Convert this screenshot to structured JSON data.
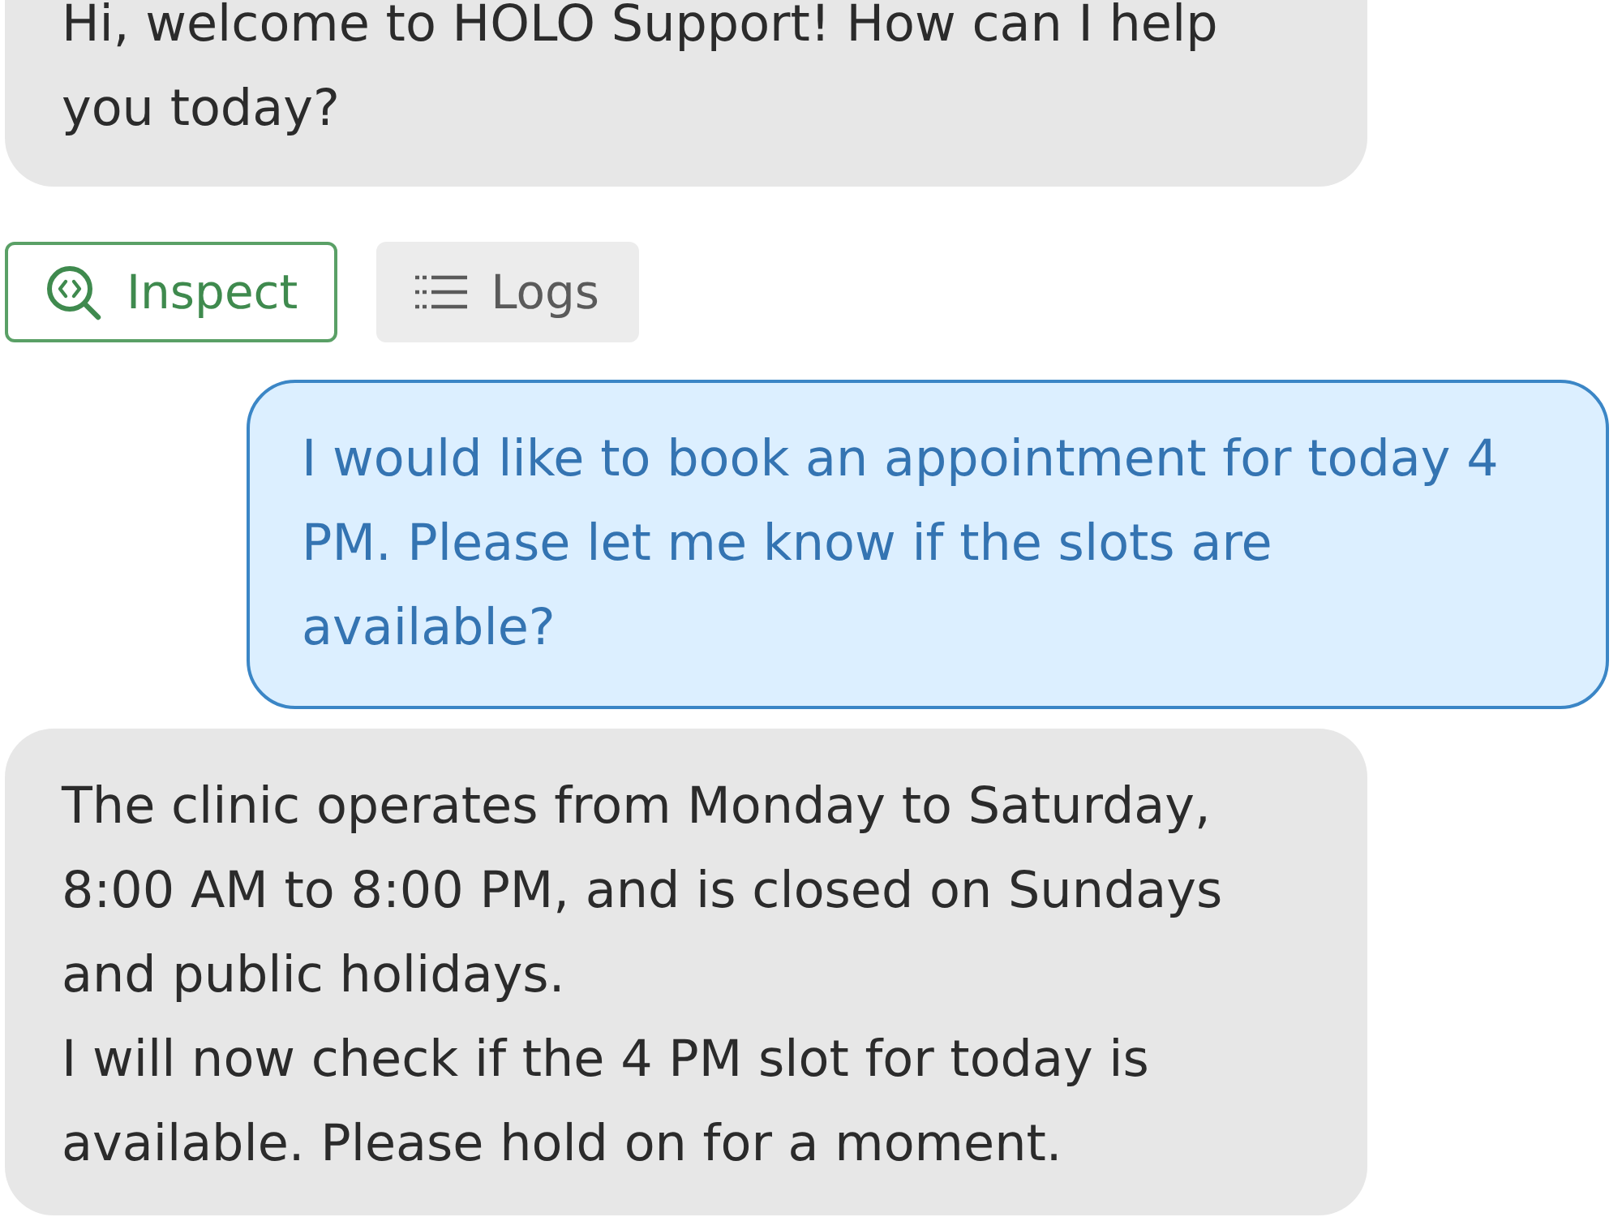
{
  "conversation": [
    {
      "kind": "incoming",
      "paragraphs": [
        "Hi, welcome to HOLO Support! How can I help you today?"
      ],
      "actions": [
        {
          "kind": "inspect",
          "label": "Inspect",
          "selected": true
        },
        {
          "kind": "logs",
          "label": "Logs",
          "selected": false
        }
      ]
    },
    {
      "kind": "outgoing",
      "paragraphs": [
        "I would like to book an appointment for today 4 PM. Please let me know if the slots are available?"
      ]
    },
    {
      "kind": "incoming",
      "paragraphs": [
        "The clinic operates from Monday to Saturday, 8:00 AM to 8:00 PM, and is closed on Sundays and public holidays.",
        "I will now check if the 4 PM slot for today is available. Please hold on for a moment."
      ]
    }
  ]
}
